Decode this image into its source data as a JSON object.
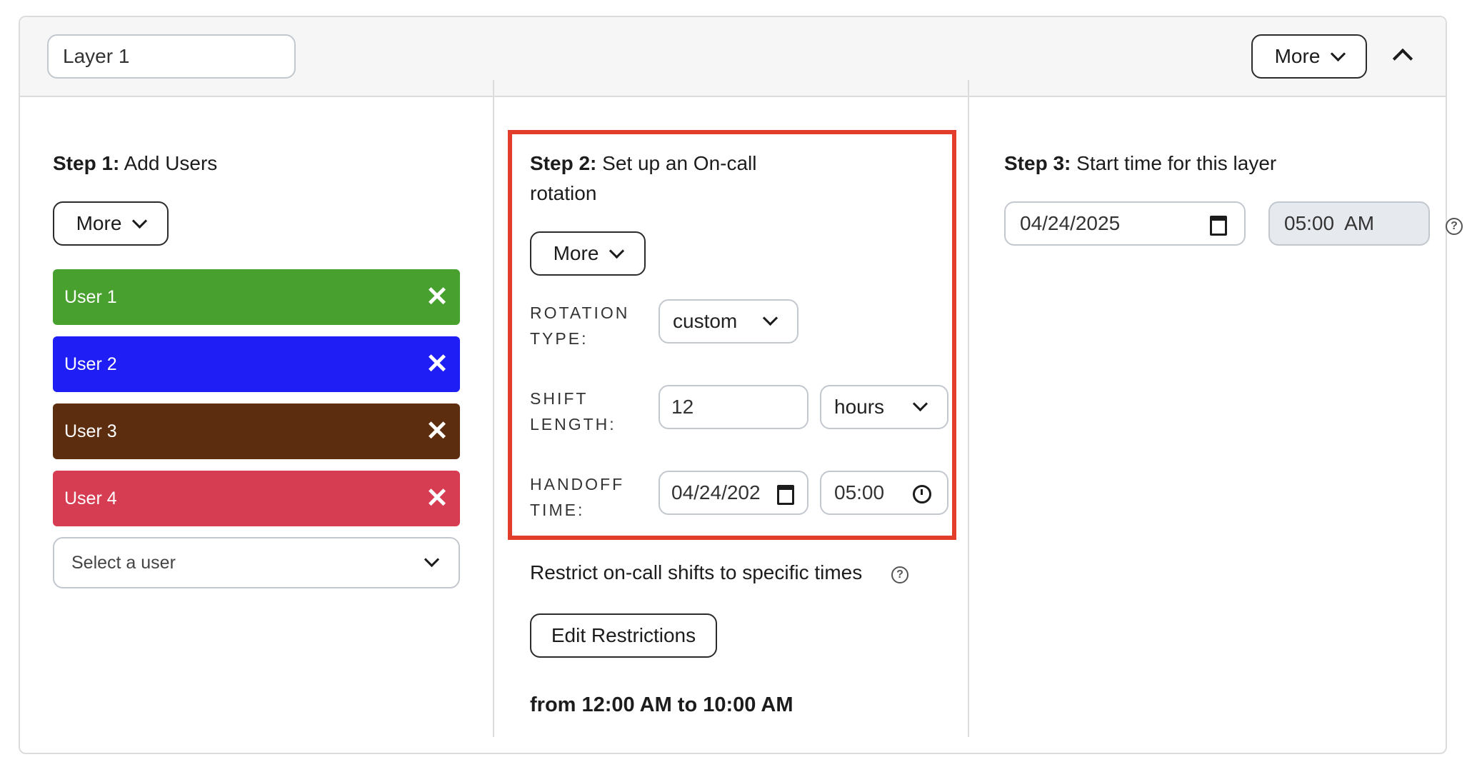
{
  "header": {
    "layer_name_value": "Layer 1",
    "more_label": "More",
    "collapse_icon": "chevron-up-icon"
  },
  "step1": {
    "title_bold": "Step 1:",
    "title_rest": "Add Users",
    "more_label": "More",
    "users": [
      {
        "label": "User 1",
        "color": "#48a02e"
      },
      {
        "label": "User 2",
        "color": "#1e1ef5"
      },
      {
        "label": "User 3",
        "color": "#5c2e0f"
      },
      {
        "label": "User 4",
        "color": "#d63c52"
      }
    ],
    "remove_glyph": "✕",
    "select_user_placeholder": "Select a user"
  },
  "step2": {
    "title_bold": "Step 2:",
    "title_rest_line1": "Set up an On-call",
    "title_rest_line2": "rotation",
    "more_label": "More",
    "rotation_type_label_1": "ROTATION",
    "rotation_type_label_2": "TYPE:",
    "rotation_type_value": "custom",
    "shift_length_label_1": "SHIFT",
    "shift_length_label_2": "LENGTH:",
    "shift_length_value": "12",
    "shift_length_unit": "hours",
    "handoff_time_label_1": "HANDOFF",
    "handoff_time_label_2": "TIME:",
    "handoff_date_value": "04/24/202",
    "handoff_time_value": "05:00",
    "restrict_text": "Restrict on-call shifts to specific times",
    "edit_restrictions_label": "Edit Restrictions",
    "restriction_range": "from 12:00 AM to 10:00 AM",
    "highlight_color": "#e23c2a"
  },
  "step3": {
    "title_bold": "Step 3:",
    "title_rest": "Start time for this layer",
    "start_date_value": "04/24/2025",
    "start_time_value": "05:00  AM"
  }
}
